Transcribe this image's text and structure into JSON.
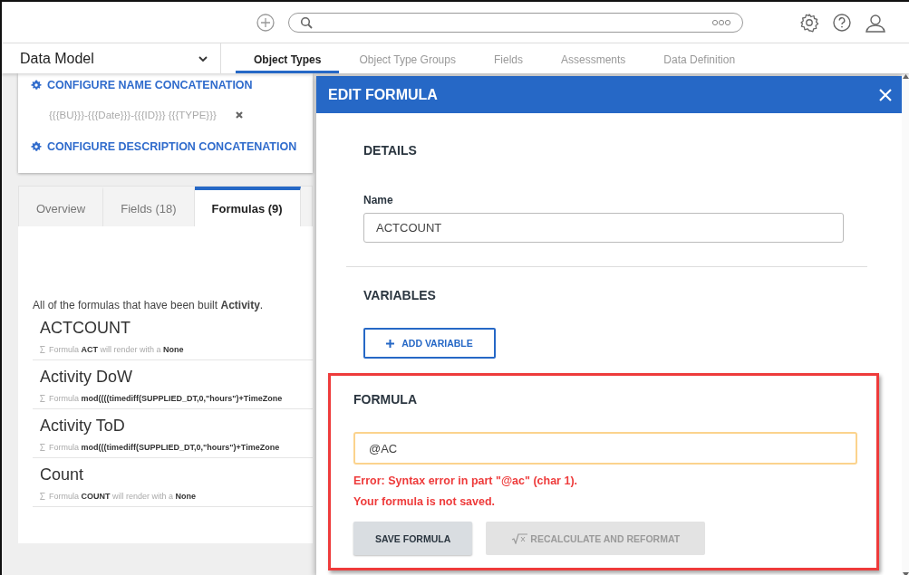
{
  "nav": {
    "module": "Data Model",
    "tabs": [
      {
        "label": "Object Types",
        "selected": true
      },
      {
        "label": "Object Type Groups",
        "selected": false
      },
      {
        "label": "Fields",
        "selected": false
      },
      {
        "label": "Assessments",
        "selected": false
      },
      {
        "label": "Data Definition",
        "selected": false
      }
    ]
  },
  "config": {
    "name_link": "CONFIGURE NAME CONCATENATION",
    "name_pattern": "{{{BU}}}-{{{Date}}}-{{{ID}}} {{{TYPE}}}",
    "description_link": "CONFIGURE DESCRIPTION CONCATENATION"
  },
  "detail_tabs": [
    {
      "label": "Overview",
      "selected": false
    },
    {
      "label": "Fields (18)",
      "selected": false
    },
    {
      "label": "Formulas (9)",
      "selected": true
    }
  ],
  "formulas": {
    "intro": "All of the formulas that have been built **Activity**.",
    "items": [
      {
        "name": "ACTCOUNT",
        "description": "Formula **ACT** will render with a **None**"
      },
      {
        "name": "Activity DoW",
        "description": "Formula **mod((((timediff(SUPPLIED_DT,0,\"hours\")+TimeZone**"
      },
      {
        "name": "Activity ToD",
        "description": "Formula **mod(((timediff(SUPPLIED_DT,0,\"hours\")+TimeZone**"
      },
      {
        "name": "Count",
        "description": "Formula **COUNT** will render with a **None**"
      }
    ]
  },
  "modal": {
    "title": "EDIT FORMULA",
    "details": {
      "heading": "DETAILS",
      "name_label": "Name",
      "name_value": "ACTCOUNT"
    },
    "variables": {
      "heading": "VARIABLES",
      "add_button": "ADD VARIABLE"
    },
    "formula": {
      "heading": "FORMULA",
      "highlighted": true,
      "value": "@AC",
      "focused": true,
      "errors": [
        "Error: Syntax error in part \"@ac\" (char 1).",
        "Your formula is not saved."
      ],
      "buttons": [
        {
          "label": "SAVE FORMULA",
          "kind": "save",
          "disabled": false
        },
        {
          "label": "RECALCULATE AND REFORMAT",
          "kind": "recalc",
          "disabled": true
        }
      ]
    }
  }
}
